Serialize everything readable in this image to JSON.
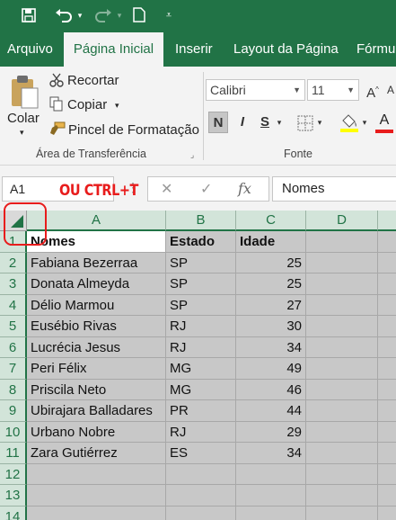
{
  "qat": {
    "save_icon": "save-icon",
    "undo_icon": "undo-icon",
    "redo_icon": "redo-icon",
    "new_icon": "new-document-icon",
    "customize_icon": "customize-qat-icon"
  },
  "tabs": [
    {
      "label": "Arquivo",
      "active": false
    },
    {
      "label": "Página Inicial",
      "active": true
    },
    {
      "label": "Inserir",
      "active": false
    },
    {
      "label": "Layout da Página",
      "active": false
    },
    {
      "label": "Fórmul",
      "active": false
    }
  ],
  "clipboard": {
    "paste_label": "Colar",
    "cut_label": "Recortar",
    "copy_label": "Copiar",
    "format_painter_label": "Pincel de Formatação",
    "group_label": "Área de Transferência"
  },
  "font": {
    "font_name": "Calibri",
    "font_size": "11",
    "grow_label": "A",
    "shrink_label": "A",
    "bold_label": "N",
    "italic_label": "I",
    "underline_label": "S",
    "font_color_label": "A",
    "group_label": "Fonte"
  },
  "formula_bar": {
    "name_box": "A1",
    "cancel_icon": "cancel-icon",
    "enter_icon": "check-icon",
    "fx_label": "fx",
    "formula": "Nomes"
  },
  "annotation": "OU CTRL+T",
  "grid": {
    "columns": [
      "A",
      "B",
      "C",
      "D"
    ],
    "rows": [
      "1",
      "2",
      "3",
      "4",
      "5",
      "6",
      "7",
      "8",
      "9",
      "10",
      "11",
      "12",
      "13",
      "14"
    ],
    "header": [
      "Nomes",
      "Estado",
      "Idade"
    ],
    "data": [
      [
        "Fabiana Bezerraa",
        "SP",
        "25"
      ],
      [
        "Donata Almeyda",
        "SP",
        "25"
      ],
      [
        "Délio Marmou",
        "SP",
        "27"
      ],
      [
        "Eusébio Rivas",
        "RJ",
        "30"
      ],
      [
        "Lucrécia Jesus",
        "RJ",
        "34"
      ],
      [
        "Peri Félix",
        "MG",
        "49"
      ],
      [
        "Priscila Neto",
        "MG",
        "46"
      ],
      [
        "Ubirajara Balladares",
        "PR",
        "44"
      ],
      [
        "Urbano Nobre",
        "RJ",
        "29"
      ],
      [
        "Zara Gutiérrez",
        "ES",
        "34"
      ]
    ]
  },
  "colors": {
    "excel_green": "#217346",
    "selection_gray": "#c8c8c8",
    "annotation_red": "#e81c1c"
  }
}
